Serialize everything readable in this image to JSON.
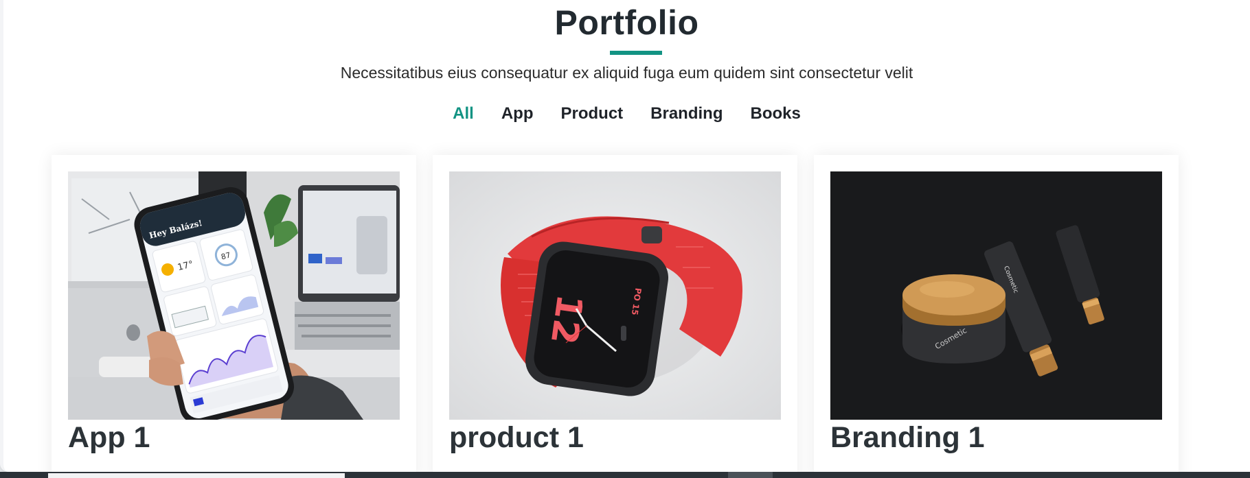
{
  "section": {
    "title": "Portfolio",
    "subtitle": "Necessitatibus eius consequatur ex aliquid fuga eum quidem sint consectetur velit",
    "accent_color": "#129383"
  },
  "filters": [
    {
      "label": "All",
      "active": true
    },
    {
      "label": "App",
      "active": false
    },
    {
      "label": "Product",
      "active": false
    },
    {
      "label": "Branding",
      "active": false
    },
    {
      "label": "Books",
      "active": false
    }
  ],
  "items": [
    {
      "title": "App 1",
      "image": "phone-app-photo"
    },
    {
      "title": "product 1",
      "image": "red-smartwatch-photo"
    },
    {
      "title": "Branding 1",
      "image": "cosmetic-products-photo"
    }
  ]
}
